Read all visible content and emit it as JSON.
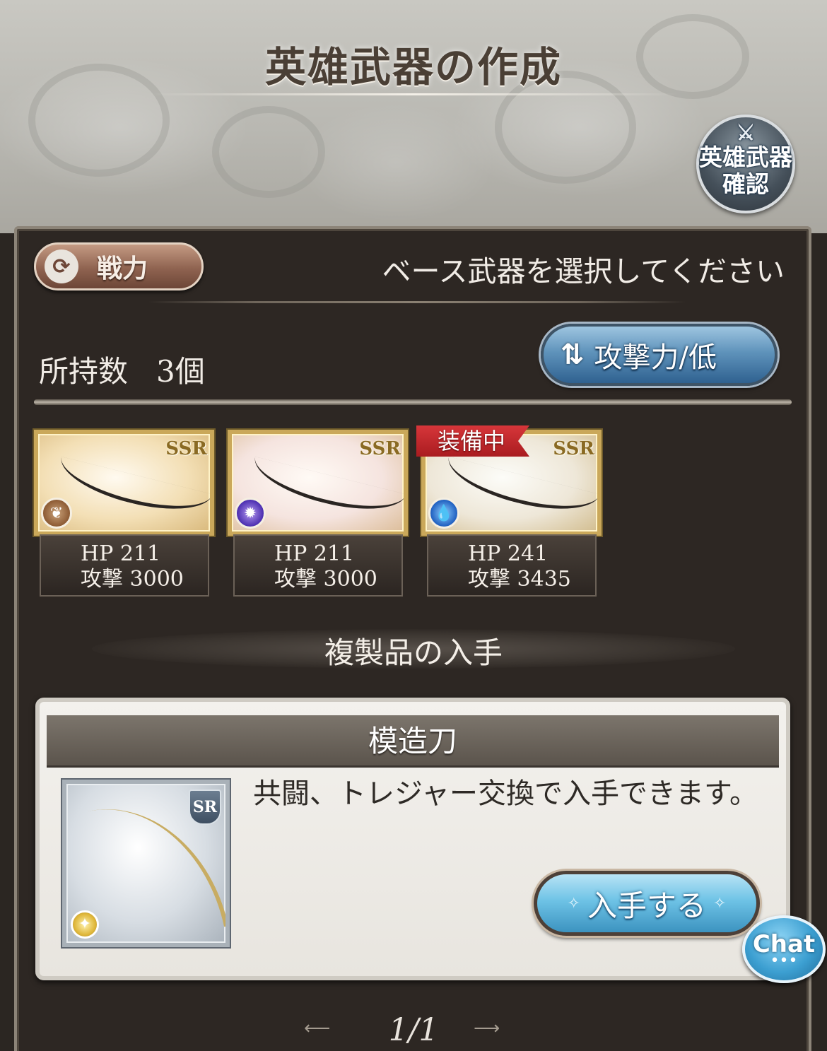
{
  "header": {
    "title": "英雄武器の作成",
    "hero_check_line1": "英雄武器",
    "hero_check_line2": "確認",
    "hero_check_icon": "crossed-swords-icon"
  },
  "toolbar": {
    "power_label": "戦力",
    "select_prompt": "ベース武器を選択してください"
  },
  "inventory": {
    "owned_label": "所持数",
    "owned_count": "3個",
    "sort_label": "攻撃力/低",
    "sort_icon": "sort-arrows-icon"
  },
  "weapons": [
    {
      "rarity": "SSR",
      "element": "wind",
      "hp": "HP  211",
      "atk": "攻撃 3000",
      "equipped": false
    },
    {
      "rarity": "SSR",
      "element": "dark",
      "hp": "HP  211",
      "atk": "攻撃 3000",
      "equipped": false
    },
    {
      "rarity": "SSR",
      "element": "water",
      "hp": "HP  241",
      "atk": "攻撃 3435",
      "equipped": true,
      "equipped_label": "装備中"
    }
  ],
  "replica": {
    "section_title": "複製品の入手",
    "name": "模造刀",
    "rarity": "SR",
    "element": "light",
    "description": "共闘、トレジャー交換で入手できます。",
    "obtain_label": "入手する"
  },
  "chat": {
    "label": "Chat"
  },
  "pager": {
    "text": "1/1"
  },
  "colors": {
    "accent_blue": "#5f93bb",
    "equipped_red": "#c62a2e",
    "panel_bg": "#2d2723"
  }
}
